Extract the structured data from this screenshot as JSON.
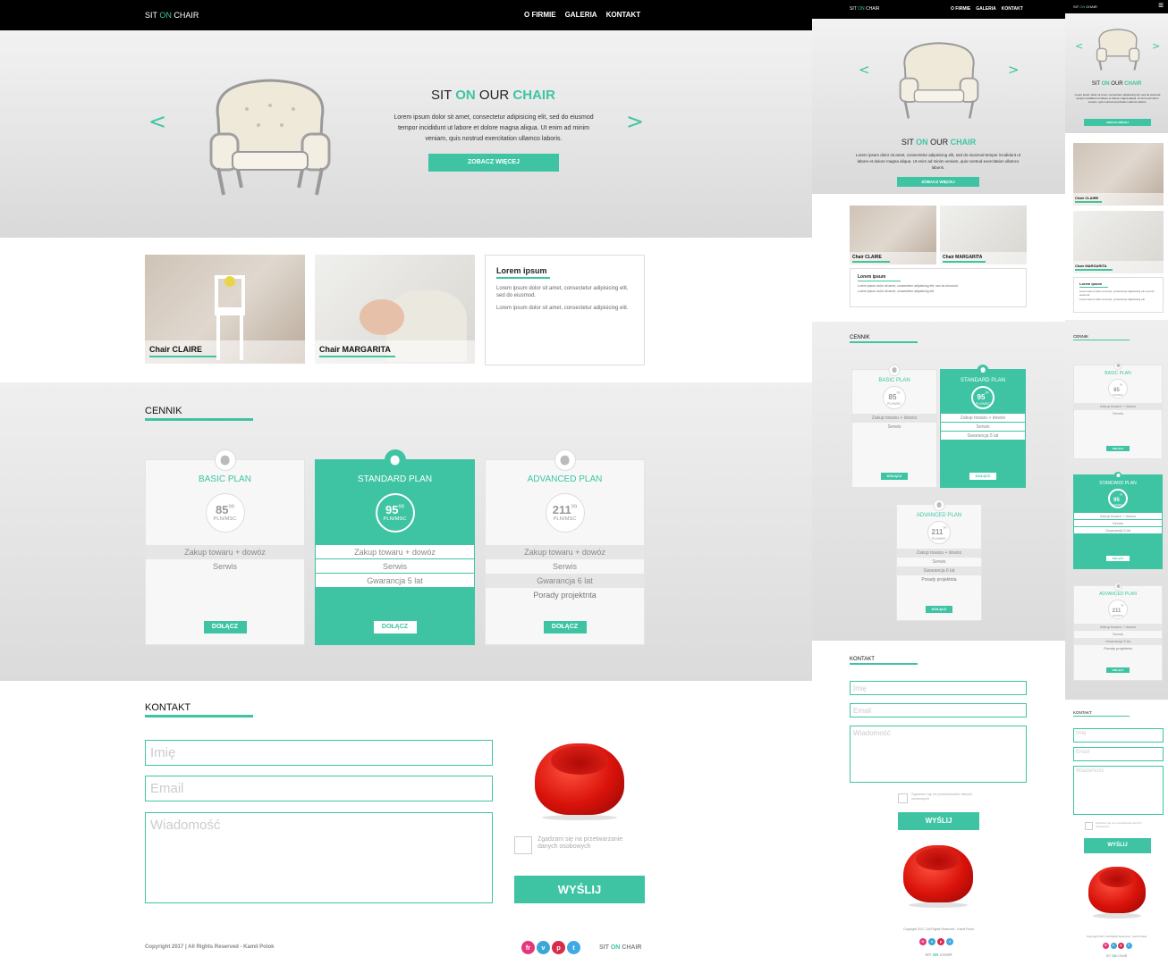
{
  "brand": {
    "part1": "SIT ",
    "part2": "ON",
    "part3": " CHAIR"
  },
  "nav": {
    "firma": "O FIRMIE",
    "galeria": "GALERIA",
    "kontakt": "KONTAKT"
  },
  "hero": {
    "title1": "SIT ",
    "title2": "ON",
    "title3": " OUR ",
    "title4": "CHAIR",
    "text": "Lorem ipsum dolor sit amet, consectetur adipisicing elit, sed do eiusmod tempor incididunt ut labore et dolore magna aliqua. Ut enim ad minim veniam, quis nostrud exercitation ullamco laboris.",
    "button": "ZOBACZ WIĘCEJ",
    "prev": "<",
    "next": ">"
  },
  "gallery": [
    {
      "caption": "Chair CLAIRE"
    },
    {
      "caption": "Chair MARGARITA"
    }
  ],
  "lorem_box": {
    "title": "Lorem ipsum",
    "p1": "Lorem ipsum dolor sit amet, consectetur adipisicing elit, sed do eiusmod.",
    "p2": "Lorem ipsum dolor sit amet, consectetur adipisicing elit."
  },
  "pricing": {
    "title": "CENNIK",
    "plans": [
      {
        "name": "BASIC PLAN",
        "price": "85",
        "cents": "99",
        "unit": "PLN/MSC",
        "features": [
          "Zakup towaru + dowóz",
          "Serwis"
        ],
        "button": "DOŁĄCZ"
      },
      {
        "name": "STANDARD PLAN",
        "price": "95",
        "cents": "99",
        "unit": "PLN/MSC",
        "features": [
          "Zakup towaru + dowóz",
          "Serwis",
          "Gwarancja 5 lat"
        ],
        "button": "DOŁĄCZ"
      },
      {
        "name": "ADVANCED PLAN",
        "price": "211",
        "cents": "99",
        "unit": "PLN/MSC",
        "features": [
          "Zakup towaru + dowóz",
          "Serwis",
          "Gwarancja 6 lat",
          "Porady projektnta"
        ],
        "button": "DOŁĄCZ"
      }
    ]
  },
  "contact": {
    "title": "KONTAKT",
    "name_placeholder": "Imię",
    "email_placeholder": "Email",
    "message_placeholder": "Wiadomość",
    "agree": "Zgadzam się na przetwarzanie danych osobowych",
    "send": "WYŚLIJ"
  },
  "footer": {
    "copyright": "Copyright 2017 | All Rights Reserved - Kamil Polok",
    "social": [
      "fr",
      "v",
      "p",
      "t"
    ]
  },
  "mobile": {
    "menu": "≡"
  },
  "colors": {
    "accent": "#3ec4a3",
    "nav": "#000000",
    "social": [
      "#e5367d",
      "#3ca7d6",
      "#d62c4b",
      "#3fa9e6"
    ]
  }
}
